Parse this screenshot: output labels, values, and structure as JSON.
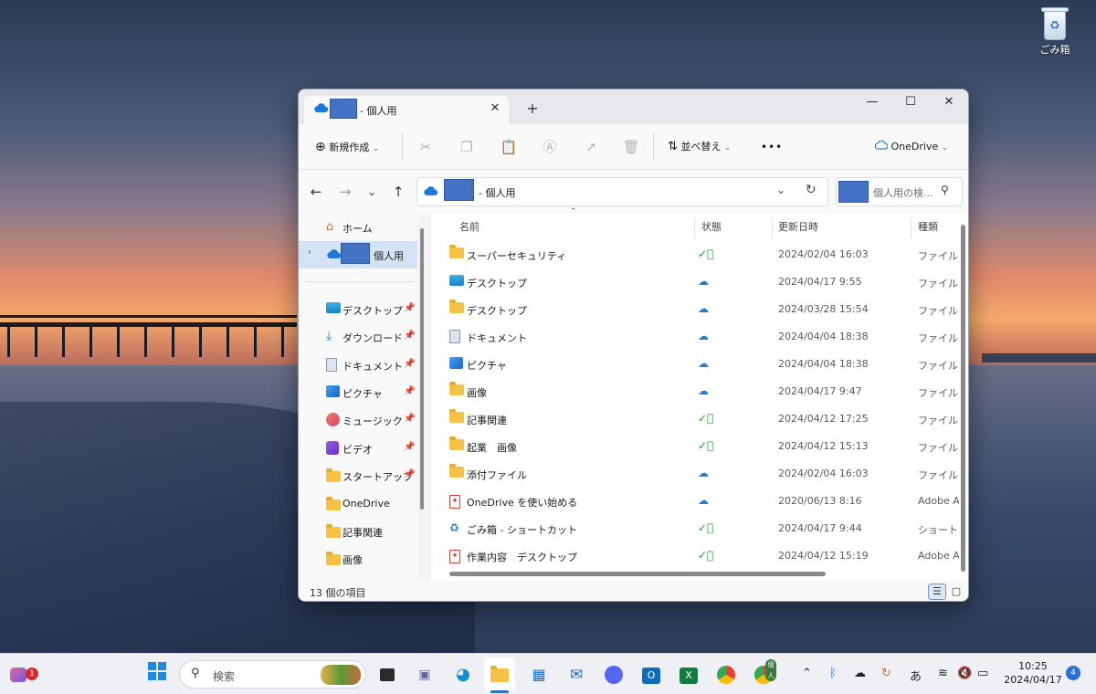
{
  "desktop": {
    "recycle_bin_label": "ごみ箱"
  },
  "window": {
    "tab_title": "- 個人用",
    "tab_close": "✕",
    "new_tab": "+",
    "minimize": "—",
    "maximize": "☐",
    "close": "✕"
  },
  "toolbar": {
    "new_label": "新規作成",
    "sort_label": "並べ替え",
    "more": "•••",
    "onedrive_label": "OneDrive"
  },
  "nav": {
    "back": "←",
    "forward": "→",
    "recent": "⌄",
    "up": "↑",
    "address_path": "- 個人用",
    "search_placeholder": "個人用の検..."
  },
  "sidebar": {
    "items": [
      {
        "label": "ホーム",
        "icon": "home-icon"
      },
      {
        "label": "個人用",
        "icon": "onedrive-icon",
        "selected": true
      },
      {
        "label": "デスクトップ",
        "icon": "desktop-icon",
        "pinned": true
      },
      {
        "label": "ダウンロード",
        "icon": "download-icon",
        "pinned": true
      },
      {
        "label": "ドキュメント",
        "icon": "document-icon",
        "pinned": true
      },
      {
        "label": "ピクチャ",
        "icon": "pictures-icon",
        "pinned": true
      },
      {
        "label": "ミュージック",
        "icon": "music-icon",
        "pinned": true
      },
      {
        "label": "ビデオ",
        "icon": "video-icon",
        "pinned": true
      },
      {
        "label": "スタートアップ",
        "icon": "folder-icon",
        "pinned": true
      },
      {
        "label": "OneDrive",
        "icon": "folder-icon"
      },
      {
        "label": "記事関連",
        "icon": "folder-icon"
      },
      {
        "label": "画像",
        "icon": "folder-icon"
      }
    ]
  },
  "columns": {
    "name": "名前",
    "status": "状態",
    "modified": "更新日時",
    "type": "種類"
  },
  "files": [
    {
      "name": "スーパーセキュリティ",
      "icon": "folder",
      "status": "available",
      "date": "2024/02/04 16:03",
      "type": "ファイル フォルダー"
    },
    {
      "name": "デスクトップ",
      "icon": "desktop",
      "status": "cloud",
      "date": "2024/04/17 9:55",
      "type": "ファイル フォルダー"
    },
    {
      "name": "デスクトップ",
      "icon": "folder",
      "status": "cloud",
      "date": "2024/03/28 15:54",
      "type": "ファイル フォルダー"
    },
    {
      "name": "ドキュメント",
      "icon": "document",
      "status": "cloud",
      "date": "2024/04/04 18:38",
      "type": "ファイル フォルダー"
    },
    {
      "name": "ピクチャ",
      "icon": "pictures",
      "status": "cloud",
      "date": "2024/04/04 18:38",
      "type": "ファイル フォルダー"
    },
    {
      "name": "画像",
      "icon": "folder",
      "status": "cloud",
      "date": "2024/04/17 9:47",
      "type": "ファイル フォルダー"
    },
    {
      "name": "記事関連",
      "icon": "folder",
      "status": "available",
      "date": "2024/04/12 17:25",
      "type": "ファイル フォルダー"
    },
    {
      "name": "起業　画像",
      "icon": "folder",
      "status": "available",
      "date": "2024/04/12 15:13",
      "type": "ファイル フォルダー"
    },
    {
      "name": "添付ファイル",
      "icon": "folder",
      "status": "cloud",
      "date": "2024/02/04 16:03",
      "type": "ファイル フォルダー"
    },
    {
      "name": "OneDrive を使い始める",
      "icon": "pdf",
      "status": "cloud",
      "date": "2020/06/13 8:16",
      "type": "Adobe Acrobat"
    },
    {
      "name": "ごみ箱 - ショートカット",
      "icon": "shortcut",
      "status": "available",
      "date": "2024/04/17 9:44",
      "type": "ショートカット"
    },
    {
      "name": "作業内容　デスクトップ",
      "icon": "pdf",
      "status": "available",
      "date": "2024/04/12 15:19",
      "type": "Adobe Acrobat"
    }
  ],
  "statusbar": {
    "count": "13 個の項目"
  },
  "taskbar": {
    "widgets_badge": "1",
    "search_label": "検索",
    "tray_ime": "あ",
    "time": "10:25",
    "date": "2024/04/17",
    "notifications": "4",
    "chrome_profile_badge": "個人"
  },
  "colors": {
    "accent": "#2a6fd4",
    "selected": "#d3e3f5",
    "folder": "#f6c245",
    "sync_ok": "#1f9d3a"
  }
}
